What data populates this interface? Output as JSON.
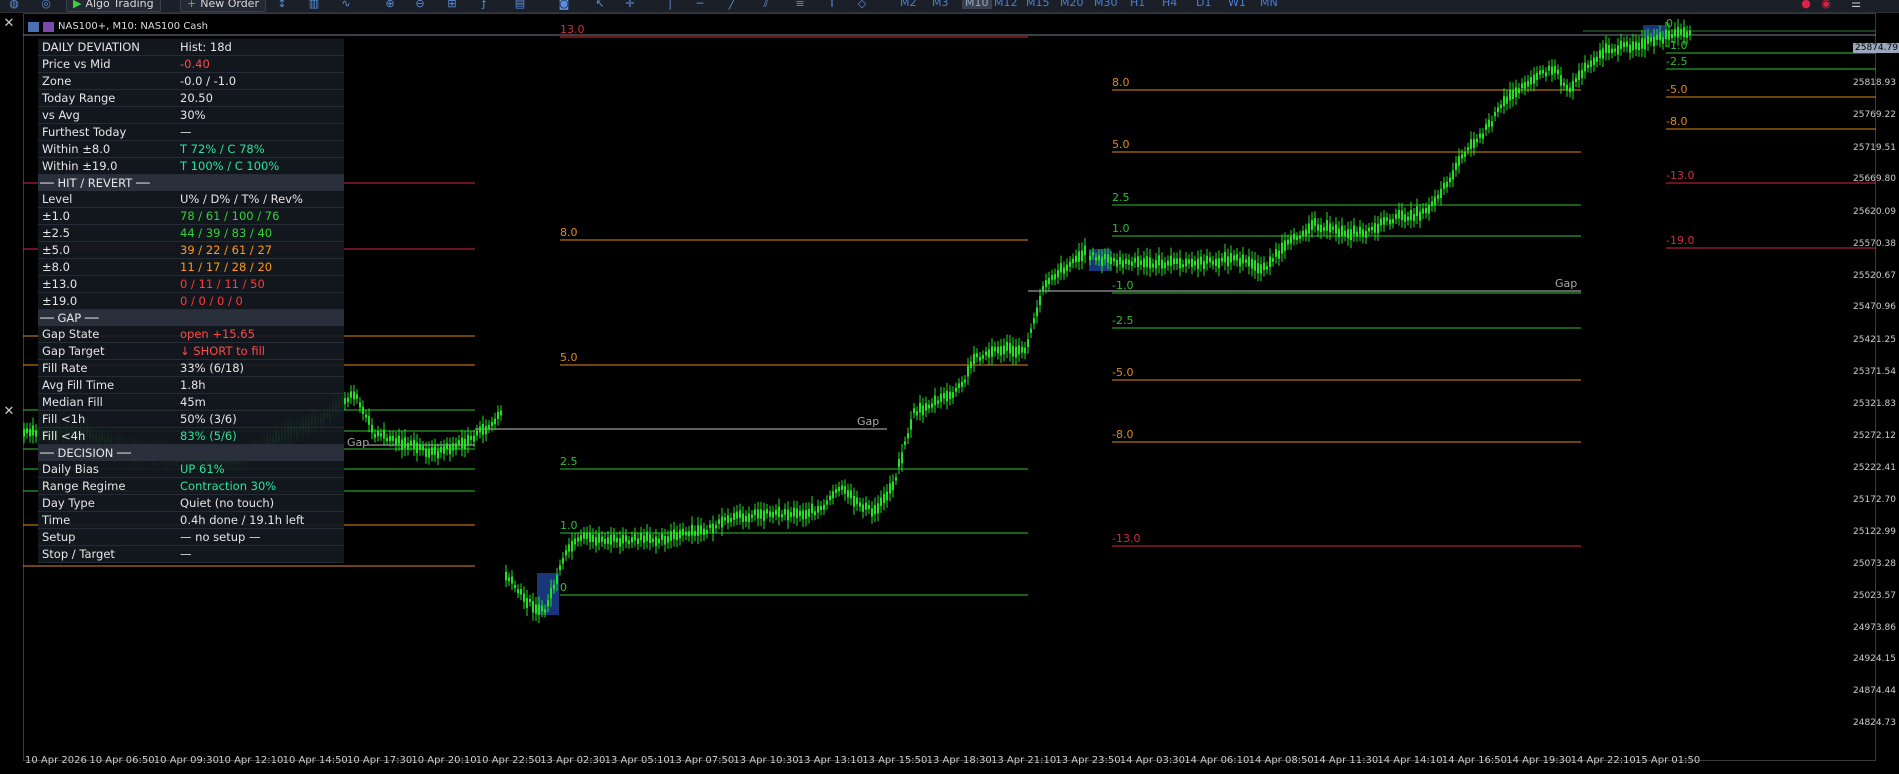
{
  "toolbar": {
    "algo_trading": "Algo Trading",
    "new_order": "New Order",
    "timeframes": [
      "M2",
      "M3",
      "M10",
      "M12",
      "M15",
      "M20",
      "M30",
      "H1",
      "H4",
      "D1",
      "W1",
      "MN"
    ],
    "active_timeframe": "M10"
  },
  "window": {
    "title": "NAS100+, M10:  NAS100 Cash"
  },
  "panel": {
    "sections": [
      {
        "header": "",
        "rows": [
          {
            "k": "DAILY DEVIATION",
            "v": "Hist: 18d",
            "color": "#e6e6e6"
          },
          {
            "k": "Price vs Mid",
            "v": "-0.40",
            "color": "#ff4a4a"
          },
          {
            "k": "Zone",
            "v": "-0.0 / -1.0",
            "color": "#e6e6e6"
          },
          {
            "k": "Today Range",
            "v": "20.50",
            "color": "#e6e6e6"
          },
          {
            "k": "vs Avg",
            "v": "30%",
            "color": "#e6e6e6"
          },
          {
            "k": "Furthest Today",
            "v": "—",
            "color": "#e6e6e6"
          },
          {
            "k": "Within ±8.0",
            "v": "T 72%  /  C 78%",
            "color": "#2ee29a"
          },
          {
            "k": "Within ±19.0",
            "v": "T 100%  /  C 100%",
            "color": "#2ee29a"
          }
        ]
      },
      {
        "header": "── HIT / REVERT ──",
        "rows": [
          {
            "k": "Level",
            "v": "U% / D% / T% / Rev%",
            "color": "#e6e6e6"
          },
          {
            "k": "±1.0",
            "v": "78 / 61 / 100 / 76",
            "color": "#34d334"
          },
          {
            "k": "±2.5",
            "v": "44 / 39 / 83 / 40",
            "color": "#34d334"
          },
          {
            "k": "±5.0",
            "v": "39 / 22 / 61 / 27",
            "color": "#ff9a1a"
          },
          {
            "k": "±8.0",
            "v": "11 / 17 / 28 / 20",
            "color": "#ff9a1a"
          },
          {
            "k": "±13.0",
            "v": "0 / 11 / 11 / 50",
            "color": "#ff3a3a"
          },
          {
            "k": "±19.0",
            "v": "0 / 0 / 0 / 0",
            "color": "#ff3a3a"
          }
        ]
      },
      {
        "header": "── GAP ──",
        "rows": [
          {
            "k": "Gap State",
            "v": "open  +15.65",
            "color": "#ff4a4a"
          },
          {
            "k": "Gap Target",
            "v": "↓ SHORT to fill",
            "color": "#ff4a4a"
          },
          {
            "k": "Fill Rate",
            "v": "33% (6/18)",
            "color": "#e6e6e6"
          },
          {
            "k": "Avg Fill Time",
            "v": "1.8h",
            "color": "#e6e6e6"
          },
          {
            "k": "Median Fill",
            "v": "45m",
            "color": "#e6e6e6"
          },
          {
            "k": "Fill <1h",
            "v": "50% (3/6)",
            "color": "#e6e6e6"
          },
          {
            "k": "Fill <4h",
            "v": "83% (5/6)",
            "color": "#2ee29a"
          }
        ]
      },
      {
        "header": "── DECISION ──",
        "rows": [
          {
            "k": "Daily Bias",
            "v": "UP 61%",
            "color": "#2ee29a"
          },
          {
            "k": "Range Regime",
            "v": "Contraction 30%",
            "color": "#2ee29a"
          },
          {
            "k": "Day Type",
            "v": "Quiet (no touch)",
            "color": "#e6e6e6"
          },
          {
            "k": "Time",
            "v": "0.4h done / 19.1h left",
            "color": "#e6e6e6"
          },
          {
            "k": "Setup",
            "v": "— no setup —",
            "color": "#e6e6e6"
          },
          {
            "k": "Stop / Target",
            "v": "—",
            "color": "#e6e6e6"
          }
        ]
      }
    ]
  },
  "x_axis": [
    "10 Apr 2026",
    "10 Apr 06:50",
    "10 Apr 09:30",
    "10 Apr 12:10",
    "10 Apr 14:50",
    "10 Apr 17:30",
    "10 Apr 20:10",
    "10 Apr 22:50",
    "13 Apr 02:30",
    "13 Apr 05:10",
    "13 Apr 07:50",
    "13 Apr 10:30",
    "13 Apr 13:10",
    "13 Apr 15:50",
    "13 Apr 18:30",
    "13 Apr 21:10",
    "13 Apr 23:50",
    "14 Apr 03:30",
    "14 Apr 06:10",
    "14 Apr 08:50",
    "14 Apr 11:30",
    "14 Apr 14:10",
    "14 Apr 16:50",
    "14 Apr 19:30",
    "14 Apr 22:10",
    "15 Apr 01:50"
  ],
  "y_axis": [
    "25874.79",
    "25818.93",
    "25769.22",
    "25719.51",
    "25669.80",
    "25620.09",
    "25570.38",
    "25520.67",
    "25470.96",
    "25421.25",
    "25371.54",
    "25321.83",
    "25272.12",
    "25222.41",
    "25172.70",
    "25122.99",
    "25073.28",
    "25023.57",
    "24973.86",
    "24924.15",
    "24874.44",
    "24824.73"
  ],
  "current_price": "25874.79",
  "gap_label": "Gap",
  "day_levels": {
    "day2": [
      {
        "label": "13.0",
        "color": "#d42a3a"
      },
      {
        "label": "8.0",
        "color": "#e08a1a"
      },
      {
        "label": "5.0",
        "color": "#e08a1a"
      },
      {
        "label": "2.5",
        "color": "#2fbf2f"
      },
      {
        "label": "1.0",
        "color": "#2fbf2f"
      },
      {
        "label": "0",
        "color": "#2fbf2f"
      }
    ],
    "day3": [
      {
        "label": "8.0",
        "color": "#e08a1a"
      },
      {
        "label": "5.0",
        "color": "#e08a1a"
      },
      {
        "label": "2.5",
        "color": "#2fbf2f"
      },
      {
        "label": "1.0",
        "color": "#2fbf2f"
      },
      {
        "label": "-1.0",
        "color": "#2fbf2f"
      },
      {
        "label": "-2.5",
        "color": "#2fbf2f"
      },
      {
        "label": "-5.0",
        "color": "#e08a1a"
      },
      {
        "label": "-8.0",
        "color": "#e08a1a"
      },
      {
        "label": "-13.0",
        "color": "#d42a3a"
      }
    ],
    "day4": [
      {
        "label": "0",
        "color": "#2fbf2f"
      },
      {
        "label": "-1.0",
        "color": "#2fbf2f"
      },
      {
        "label": "-2.5",
        "color": "#2fbf2f"
      },
      {
        "label": "-5.0",
        "color": "#e08a1a"
      },
      {
        "label": "-8.0",
        "color": "#e08a1a"
      },
      {
        "label": "-13.0",
        "color": "#d42a3a"
      },
      {
        "label": "-19.0",
        "color": "#d42a3a"
      }
    ]
  },
  "colors": {
    "candle": "#22e022",
    "background": "#000000",
    "gap_line": "#c0c0c0",
    "box": "#1f3f8f"
  }
}
